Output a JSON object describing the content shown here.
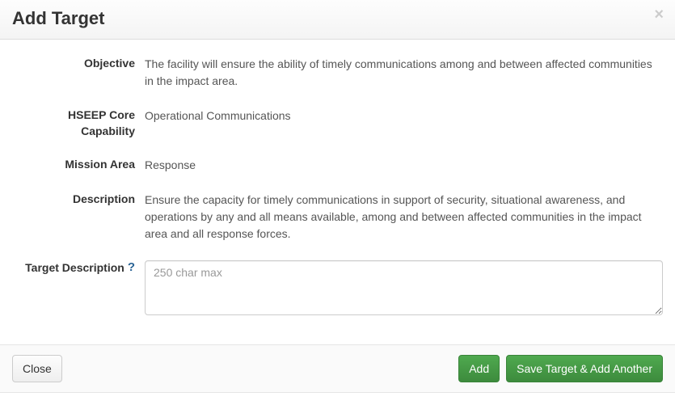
{
  "header": {
    "title": "Add Target",
    "close_x": "×"
  },
  "fields": {
    "objective": {
      "label": "Objective",
      "value": "The facility will ensure the ability of timely communications among and between affected communities in the impact area."
    },
    "hseep": {
      "label": "HSEEP Core Capability",
      "value": "Operational Communications"
    },
    "mission_area": {
      "label": "Mission Area",
      "value": "Response"
    },
    "description": {
      "label": "Description",
      "value": "Ensure the capacity for timely communications in support of security, situational awareness, and operations by any and all means available, among and between affected communities in the impact area and all response forces."
    },
    "target_description": {
      "label": "Target Description",
      "help_icon": "?",
      "placeholder": "250 char max",
      "value": ""
    }
  },
  "footer": {
    "close": "Close",
    "add": "Add",
    "save_another": "Save Target & Add Another"
  }
}
